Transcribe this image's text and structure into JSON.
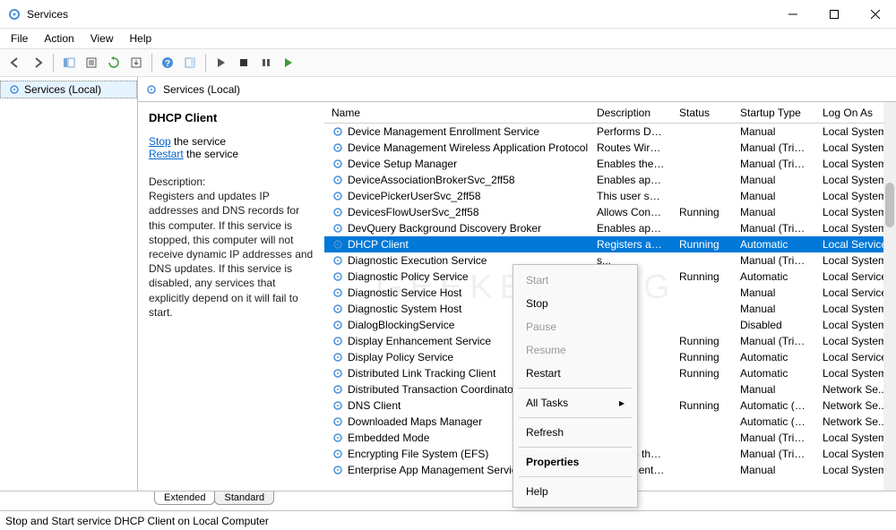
{
  "window": {
    "title": "Services"
  },
  "menu": {
    "file": "File",
    "action": "Action",
    "view": "View",
    "help": "Help"
  },
  "tree": {
    "root": "Services (Local)"
  },
  "paneHeader": "Services (Local)",
  "detail": {
    "title": "DHCP Client",
    "stopLink": "Stop",
    "stopSuffix": " the service",
    "restartLink": "Restart",
    "restartSuffix": " the service",
    "descLabel": "Description:",
    "descText": "Registers and updates IP addresses and DNS records for this computer. If this service is stopped, this computer will not receive dynamic IP addresses and DNS updates. If this service is disabled, any services that explicitly depend on it will fail to start."
  },
  "columns": {
    "name": "Name",
    "description": "Description",
    "status": "Status",
    "startup": "Startup Type",
    "logon": "Log On As"
  },
  "services": [
    {
      "name": "Device Management Enrollment Service",
      "desc": "Performs De...",
      "status": "",
      "startup": "Manual",
      "logon": "Local System"
    },
    {
      "name": "Device Management Wireless Application Protocol (WA...",
      "desc": "Routes Wirel...",
      "status": "",
      "startup": "Manual (Trigg...",
      "logon": "Local System"
    },
    {
      "name": "Device Setup Manager",
      "desc": "Enables the ...",
      "status": "",
      "startup": "Manual (Trigg...",
      "logon": "Local System"
    },
    {
      "name": "DeviceAssociationBrokerSvc_2ff58",
      "desc": "Enables app...",
      "status": "",
      "startup": "Manual",
      "logon": "Local System"
    },
    {
      "name": "DevicePickerUserSvc_2ff58",
      "desc": "This user ser...",
      "status": "",
      "startup": "Manual",
      "logon": "Local System"
    },
    {
      "name": "DevicesFlowUserSvc_2ff58",
      "desc": "Allows Conn...",
      "status": "Running",
      "startup": "Manual",
      "logon": "Local System"
    },
    {
      "name": "DevQuery Background Discovery Broker",
      "desc": "Enables app...",
      "status": "",
      "startup": "Manual (Trigg...",
      "logon": "Local System"
    },
    {
      "name": "DHCP Client",
      "desc": "Registers an...",
      "status": "Running",
      "startup": "Automatic",
      "logon": "Local Service",
      "selected": true
    },
    {
      "name": "Diagnostic Execution Service",
      "desc": "s...",
      "status": "",
      "startup": "Manual (Trigg...",
      "logon": "Local System"
    },
    {
      "name": "Diagnostic Policy Service",
      "desc": "s...",
      "status": "Running",
      "startup": "Automatic",
      "logon": "Local Service"
    },
    {
      "name": "Diagnostic Service Host",
      "desc": "s...",
      "status": "",
      "startup": "Manual",
      "logon": "Local Service"
    },
    {
      "name": "Diagnostic System Host",
      "desc": "s...",
      "status": "",
      "startup": "Manual",
      "logon": "Local System"
    },
    {
      "name": "DialogBlockingService",
      "desc": "k...",
      "status": "",
      "startup": "Disabled",
      "logon": "Local System"
    },
    {
      "name": "Display Enhancement Service",
      "desc": "r...",
      "status": "Running",
      "startup": "Manual (Trigg...",
      "logon": "Local System"
    },
    {
      "name": "Display Policy Service",
      "desc": "r...",
      "status": "Running",
      "startup": "Automatic",
      "logon": "Local Service"
    },
    {
      "name": "Distributed Link Tracking Client",
      "desc": "...",
      "status": "Running",
      "startup": "Automatic",
      "logon": "Local System"
    },
    {
      "name": "Distributed Transaction Coordinator",
      "desc": "s ...",
      "status": "",
      "startup": "Manual",
      "logon": "Network Se..."
    },
    {
      "name": "DNS Client",
      "desc": "...",
      "status": "Running",
      "startup": "Automatic (Tri...",
      "logon": "Network Se..."
    },
    {
      "name": "Downloaded Maps Manager",
      "desc": "...",
      "status": "",
      "startup": "Automatic (De...",
      "logon": "Network Se..."
    },
    {
      "name": "Embedded Mode",
      "desc": "...",
      "status": "",
      "startup": "Manual (Trigg...",
      "logon": "Local System"
    },
    {
      "name": "Encrypting File System (EFS)",
      "desc": "Provides the...",
      "status": "",
      "startup": "Manual (Trigg...",
      "logon": "Local System"
    },
    {
      "name": "Enterprise App Management Service",
      "desc": "Enables ente...",
      "status": "",
      "startup": "Manual",
      "logon": "Local System"
    }
  ],
  "tabs": {
    "extended": "Extended",
    "standard": "Standard"
  },
  "statusbar": "Stop and Start service DHCP Client on Local Computer",
  "context": {
    "start": "Start",
    "stop": "Stop",
    "pause": "Pause",
    "resume": "Resume",
    "restart": "Restart",
    "allTasks": "All Tasks",
    "refresh": "Refresh",
    "properties": "Properties",
    "help": "Help"
  },
  "watermark": "GEEKER   MAG"
}
